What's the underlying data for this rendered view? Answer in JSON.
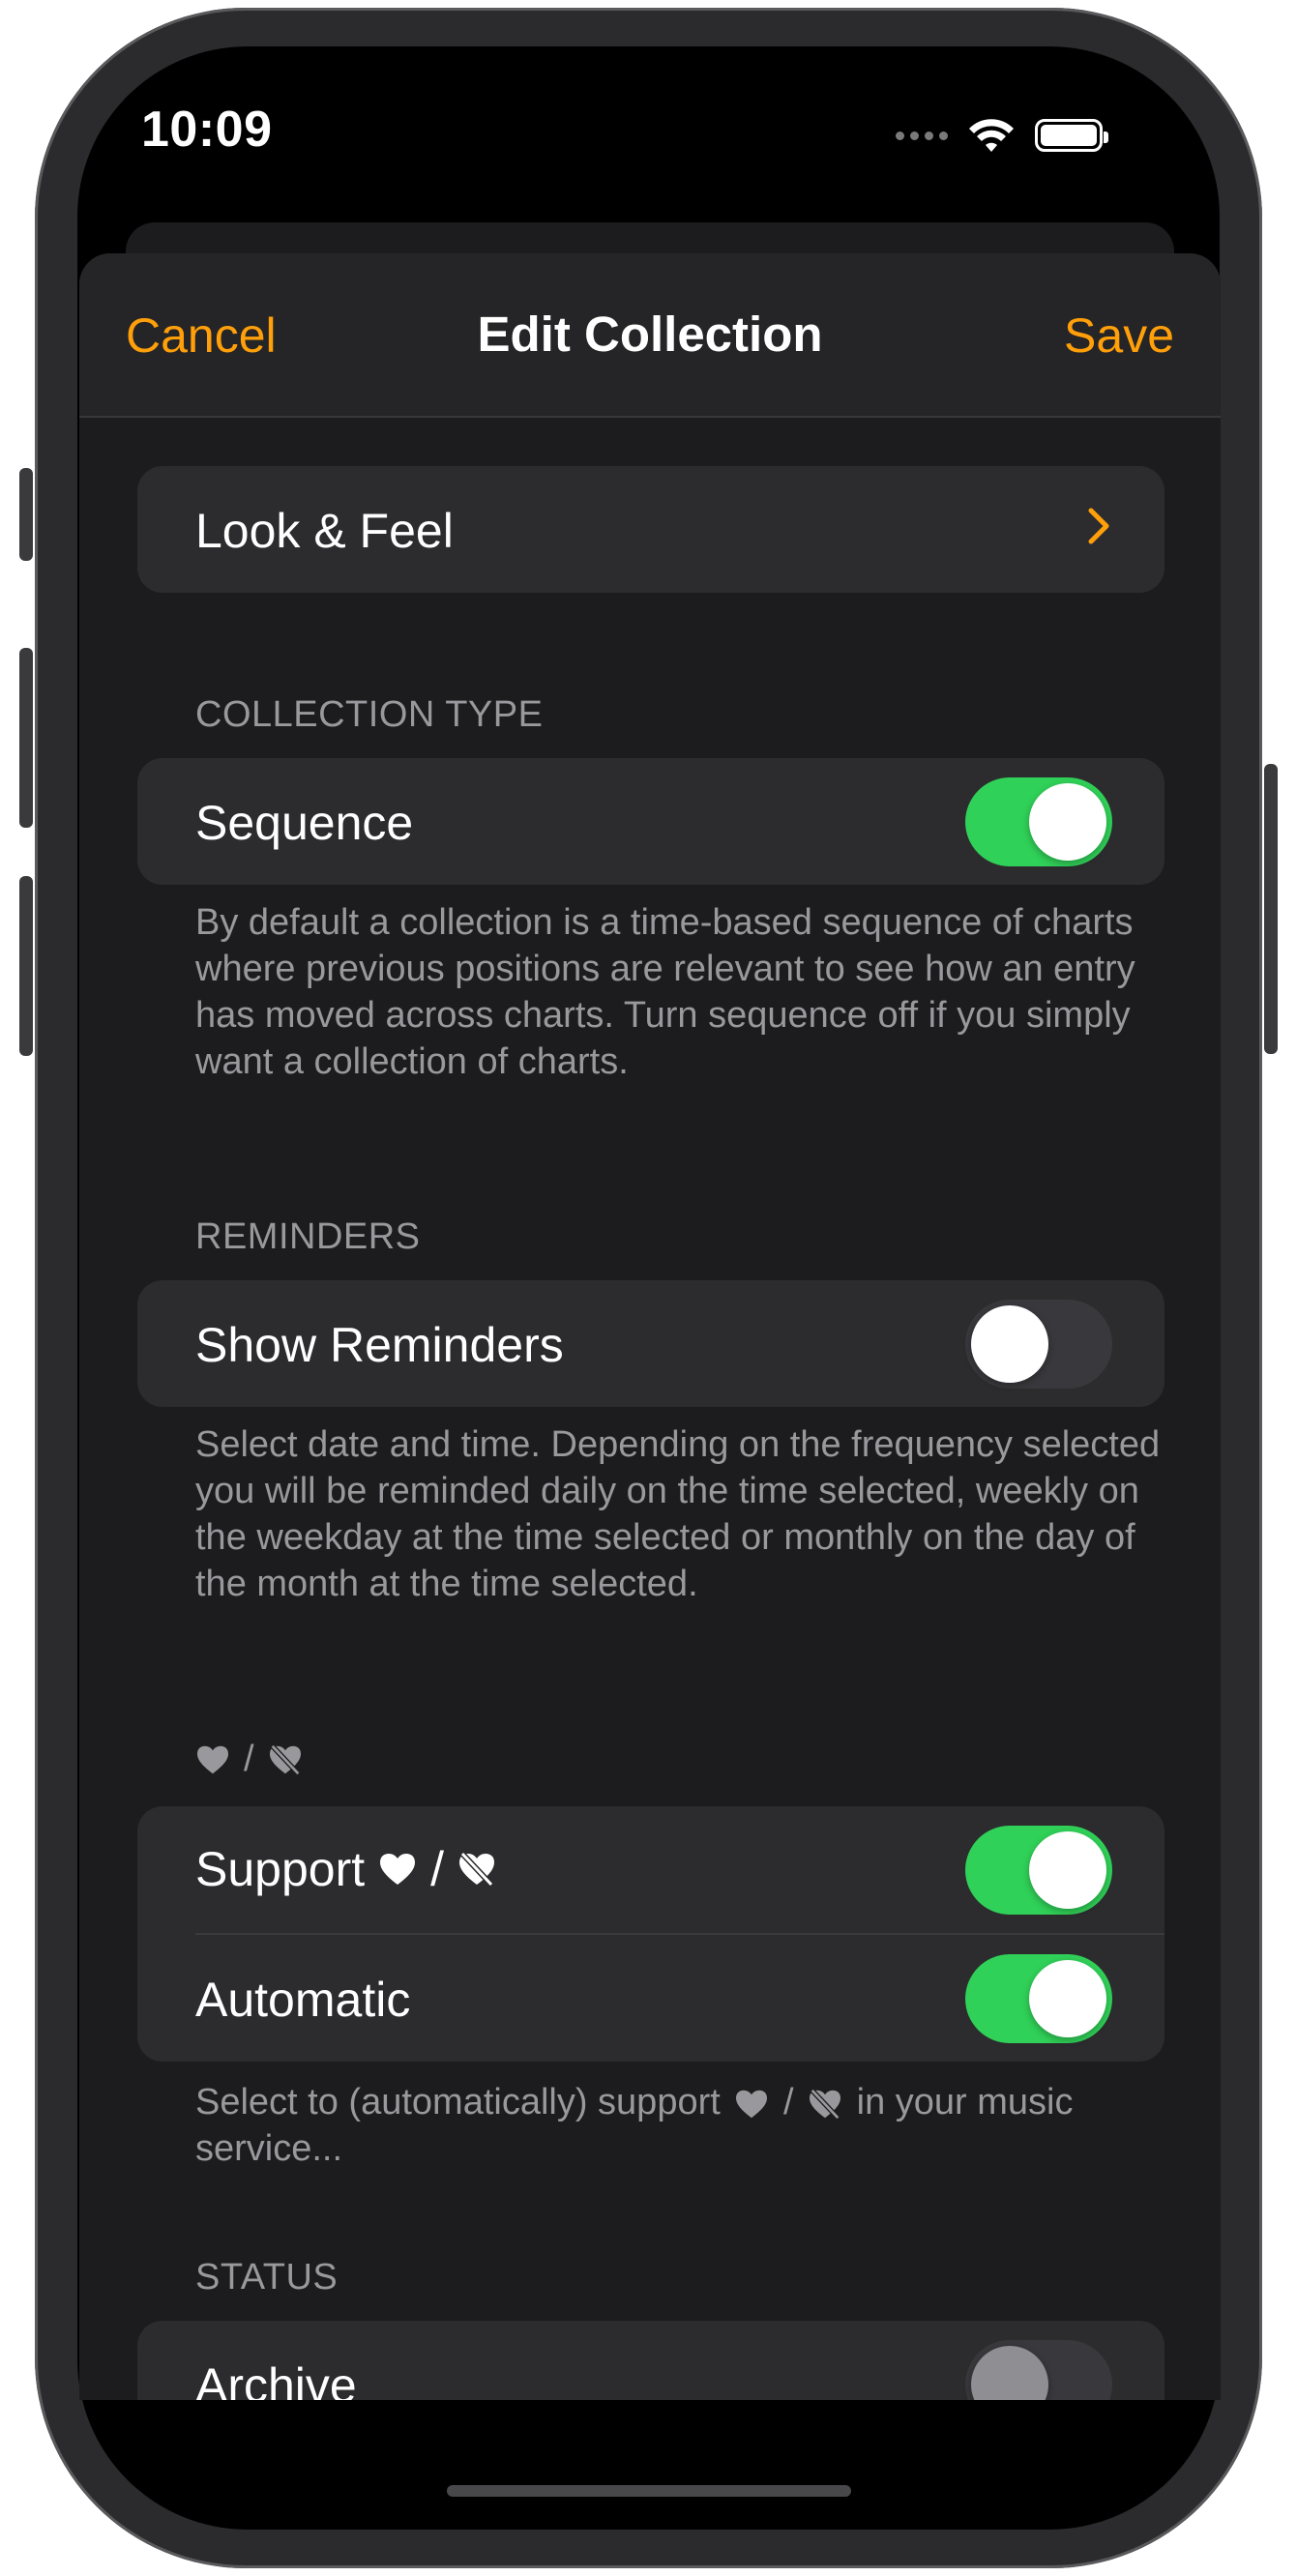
{
  "status_bar": {
    "time": "10:09"
  },
  "nav": {
    "cancel": "Cancel",
    "title": "Edit Collection",
    "save": "Save"
  },
  "look_feel": {
    "label": "Look & Feel"
  },
  "collection_type": {
    "header": "COLLECTION TYPE",
    "sequence_label": "Sequence",
    "sequence_on": true,
    "footer": "By default a collection is a time-based sequence of charts where previous positions are relevant to see how an entry has moved across charts. Turn sequence off if you simply want a collection of charts."
  },
  "reminders": {
    "header": "REMINDERS",
    "show_label": "Show Reminders",
    "show_on": false,
    "footer": "Select date and time. Depending on the frequency selected you will be reminded daily on the time selected, weekly on the weekday at the time selected or monthly on the day of the month at the time selected."
  },
  "love": {
    "header_sep": "/",
    "support_label": "Support",
    "support_sep": "/",
    "support_on": true,
    "automatic_label": "Automatic",
    "automatic_on": true,
    "footer_pre": "Select to (automatically) support",
    "footer_sep": "/",
    "footer_post": "in your music service..."
  },
  "status": {
    "header": "STATUS",
    "archive_label": "Archive",
    "archive_on": false
  },
  "colors": {
    "accent": "#ff9f0a",
    "toggle_on": "#30d158",
    "background": "#1c1c1e",
    "cell": "#2c2c2e"
  },
  "icons": [
    "wifi-icon",
    "battery-icon",
    "chevron-right-icon",
    "heart-icon",
    "heart-slash-icon"
  ]
}
